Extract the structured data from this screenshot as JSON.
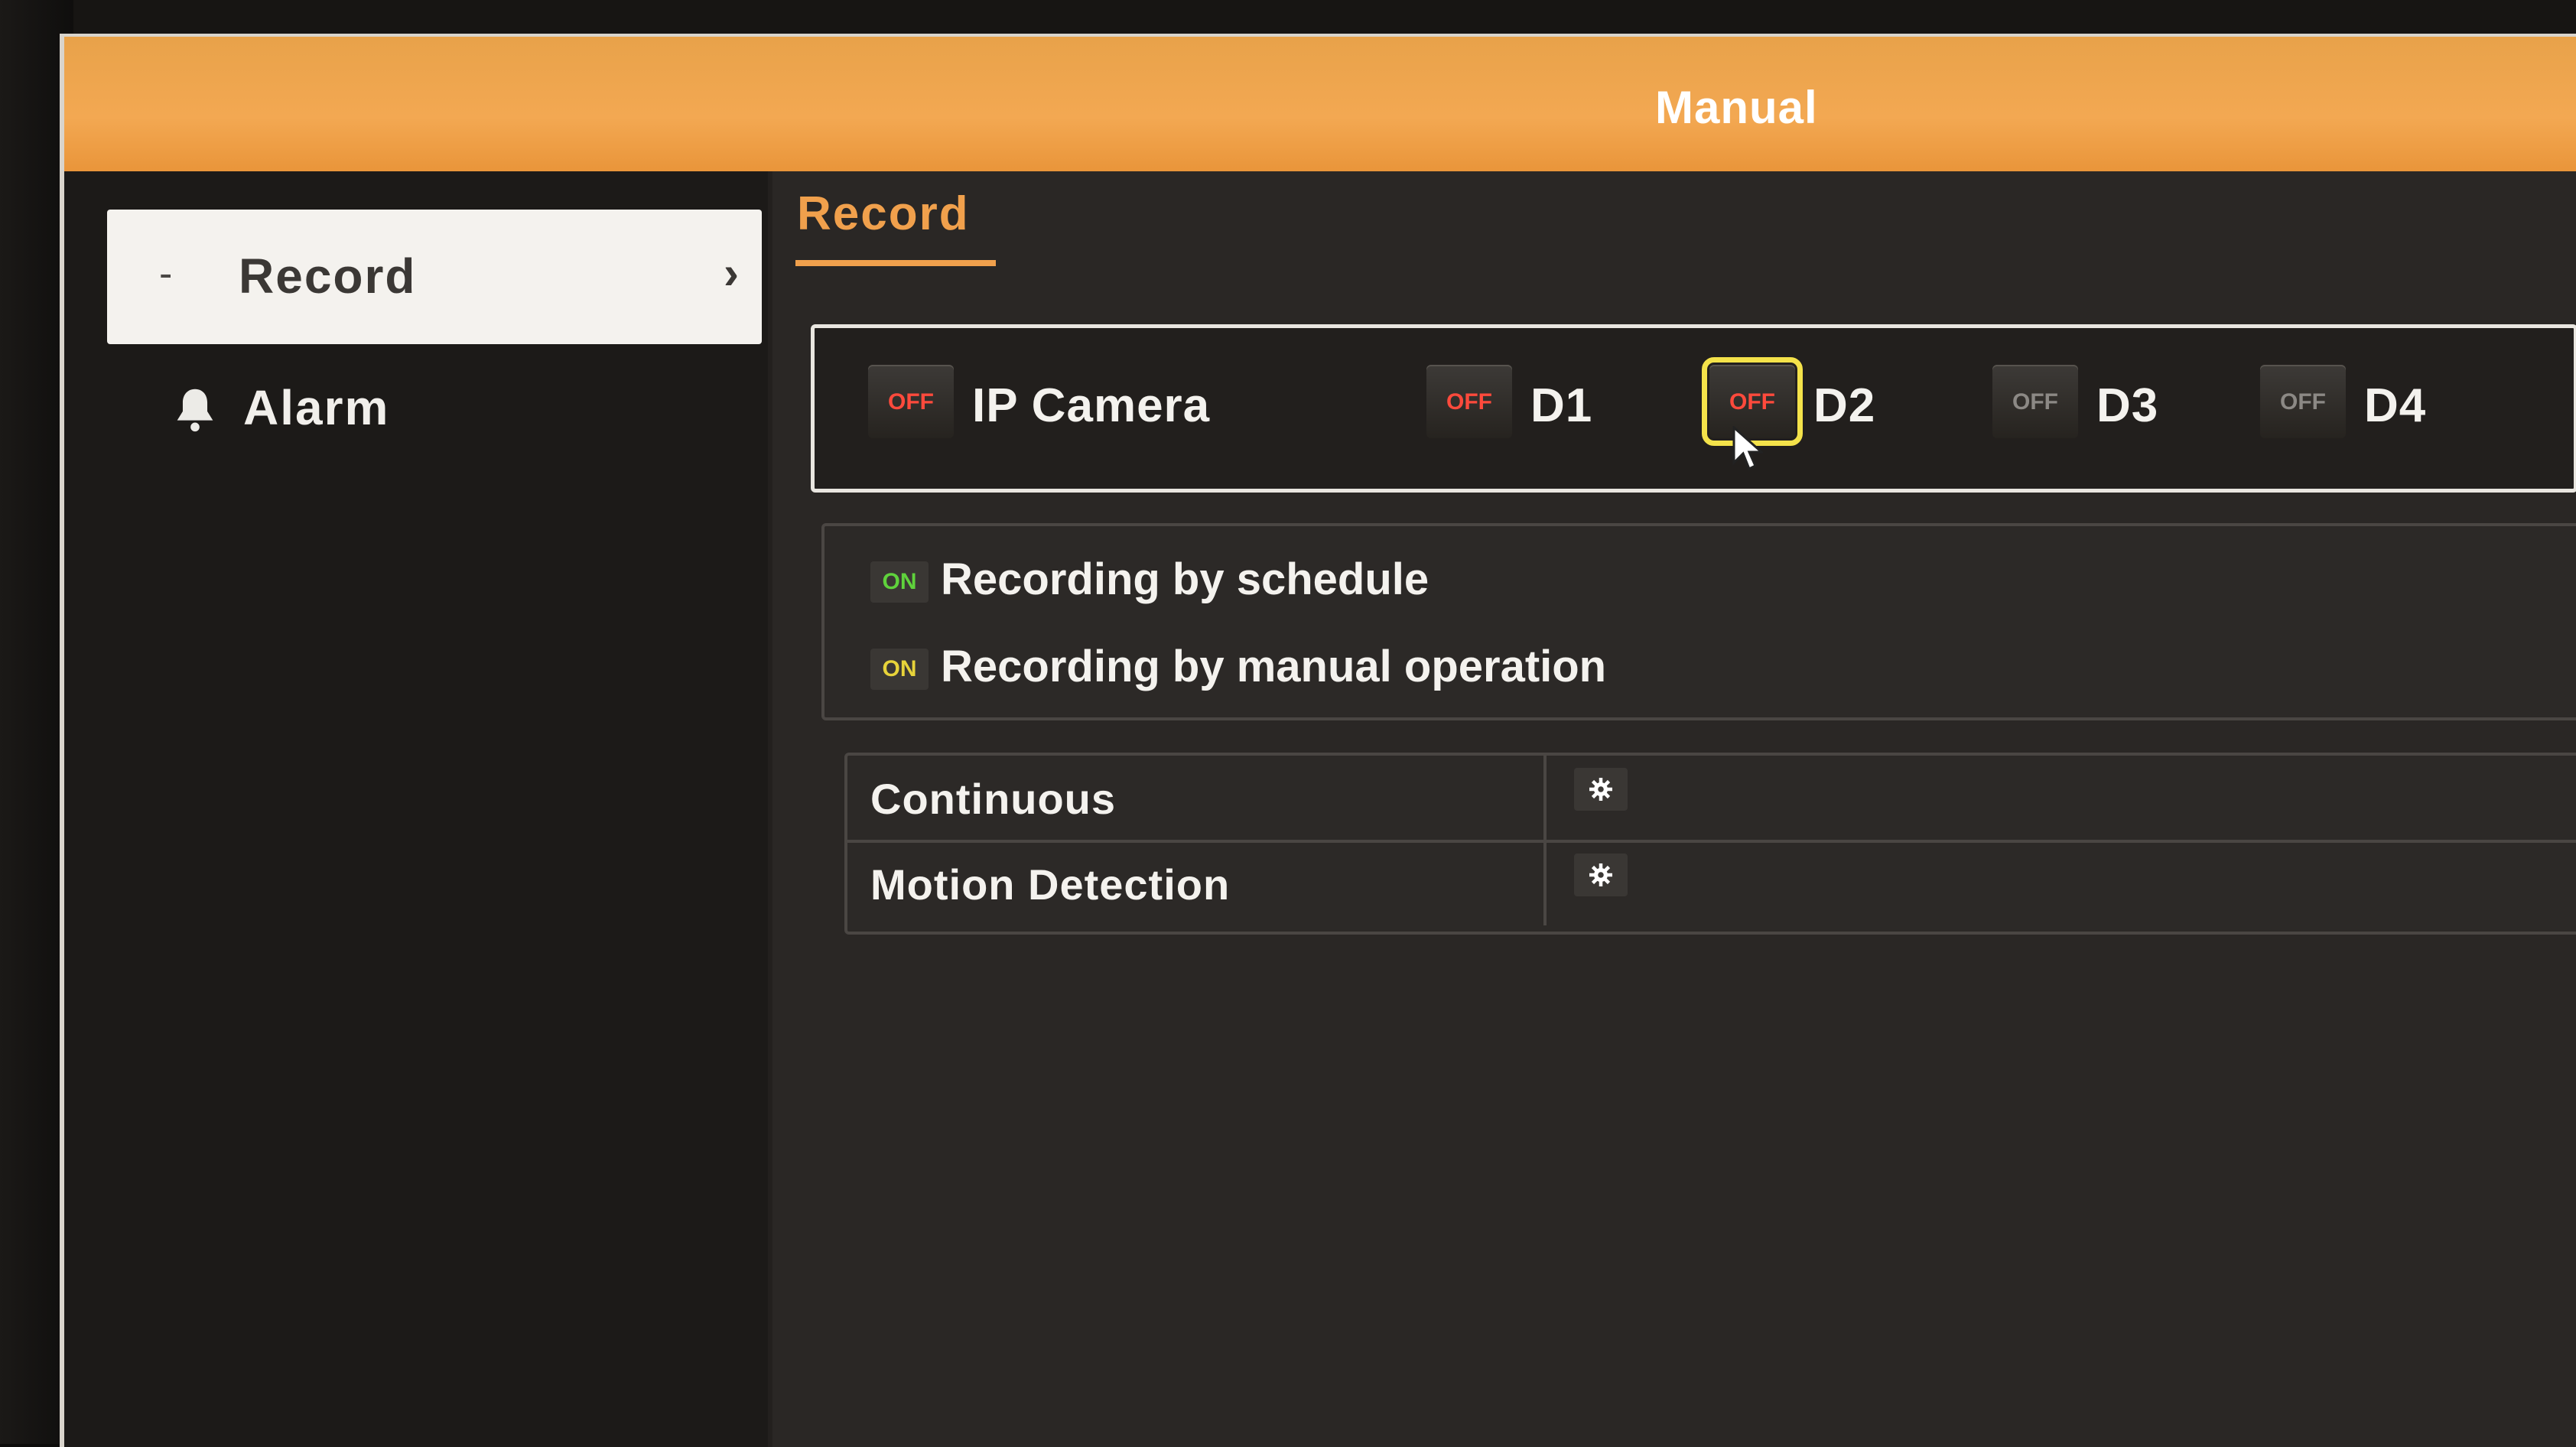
{
  "window": {
    "title": "Manual"
  },
  "sidebar": {
    "items": [
      {
        "label": "Record",
        "prefix": "-",
        "suffix": "›",
        "selected": true,
        "icon": "dash-icon"
      },
      {
        "label": "Alarm",
        "selected": false,
        "icon": "bell-icon"
      }
    ]
  },
  "tabs": [
    {
      "label": "Record",
      "active": true
    }
  ],
  "channels": [
    {
      "name": "IP Camera",
      "toggle": "OFF",
      "state": "active"
    },
    {
      "name": "D1",
      "toggle": "OFF",
      "state": "active"
    },
    {
      "name": "D2",
      "toggle": "OFF",
      "state": "active",
      "focused": true
    },
    {
      "name": "D3",
      "toggle": "OFF",
      "state": "dim"
    },
    {
      "name": "D4",
      "toggle": "OFF",
      "state": "dim"
    }
  ],
  "legend": [
    {
      "badge": "ON",
      "color": "#5fd23c",
      "text": "Recording by schedule"
    },
    {
      "badge": "ON",
      "color": "#e7d33a",
      "text": "Recording by manual operation"
    }
  ],
  "record_types": [
    {
      "label": "Continuous",
      "icon": "gear-icon"
    },
    {
      "label": "Motion Detection",
      "icon": "gear-icon"
    }
  ],
  "colors": {
    "titlebar": "#f3a852",
    "accent": "#f0a04c",
    "off_text": "#ff4a3c",
    "focus": "#f4e24a"
  }
}
